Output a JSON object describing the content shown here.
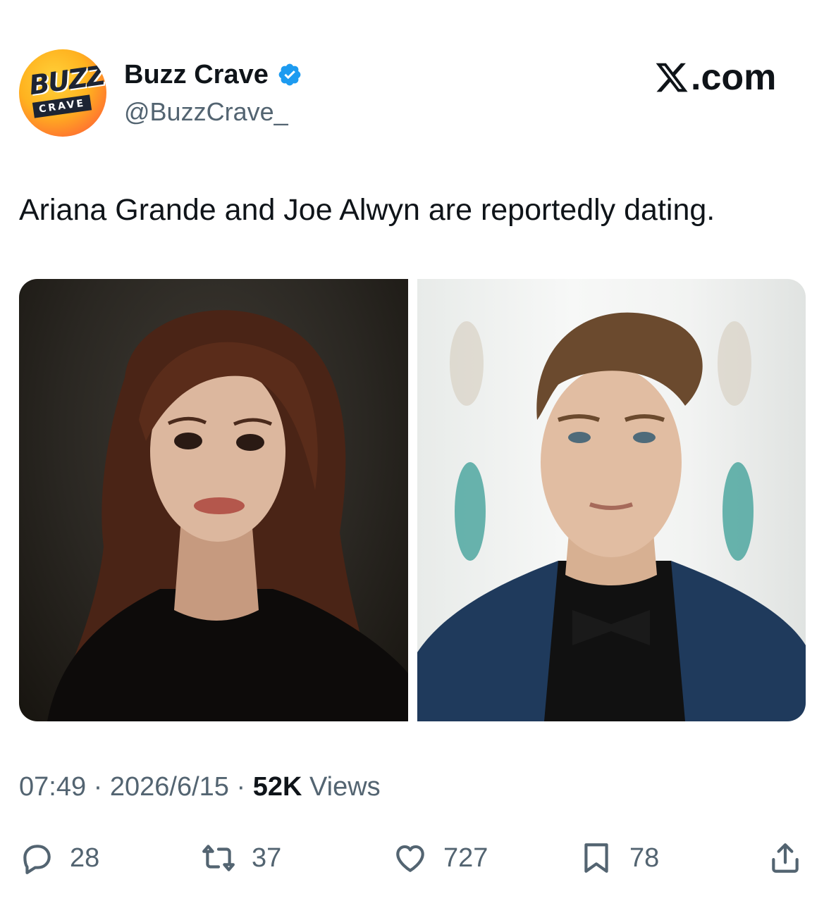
{
  "author": {
    "avatar_line1": "BUZZ",
    "avatar_line2": "CRAVE",
    "display_name": "Buzz Crave",
    "handle": "@BuzzCrave_",
    "verified_color": "#1d9bf0"
  },
  "site": {
    "label": ".com",
    "logo_icon": "x-logo-icon"
  },
  "tweet": {
    "text": "Ariana Grande and Joe Alwyn are reportedly dating.",
    "images": [
      {
        "description_icon": "photo-woman-portrait"
      },
      {
        "description_icon": "photo-man-portrait"
      }
    ]
  },
  "meta": {
    "time": "07:49",
    "sep1": " · ",
    "date": "2026/6/15",
    "sep2": " · ",
    "views_count": "52K",
    "views_label": " Views"
  },
  "actions": {
    "reply_count": "28",
    "retweet_count": "37",
    "like_count": "727",
    "bookmark_count": "78"
  },
  "colors": {
    "text_primary": "#0f1419",
    "text_secondary": "#536471",
    "verified_blue": "#1d9bf0"
  }
}
